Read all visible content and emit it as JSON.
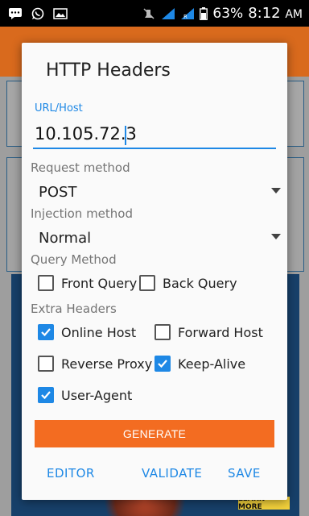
{
  "status_bar": {
    "battery": "63%",
    "time": "8:12",
    "ampm": "AM"
  },
  "dialog": {
    "title": "HTTP Headers",
    "url": {
      "label": "URL/Host",
      "value": "10.105.72.3"
    },
    "request_method": {
      "label": "Request method",
      "selected": "POST"
    },
    "injection_method": {
      "label": "Injection method",
      "selected": "Normal"
    },
    "query_method": {
      "label": "Query Method",
      "options": [
        {
          "label": "Front Query",
          "checked": false
        },
        {
          "label": "Back Query",
          "checked": false
        }
      ]
    },
    "extra_headers": {
      "label": "Extra Headers",
      "options": [
        {
          "label": "Online Host",
          "checked": true
        },
        {
          "label": "Forward Host",
          "checked": false
        },
        {
          "label": "Reverse Proxy",
          "checked": false
        },
        {
          "label": "Keep-Alive",
          "checked": true
        },
        {
          "label": "User-Agent",
          "checked": true
        }
      ]
    },
    "generate_label": "GENERATE",
    "actions": {
      "editor": "EDITOR",
      "validate": "VALIDATE",
      "save": "SAVE"
    }
  },
  "ad": {
    "cta": "LEARN MORE"
  },
  "colors": {
    "accent": "#1e88e5",
    "generate_button": "#f36c21",
    "app_bar": "#d96a1d"
  }
}
